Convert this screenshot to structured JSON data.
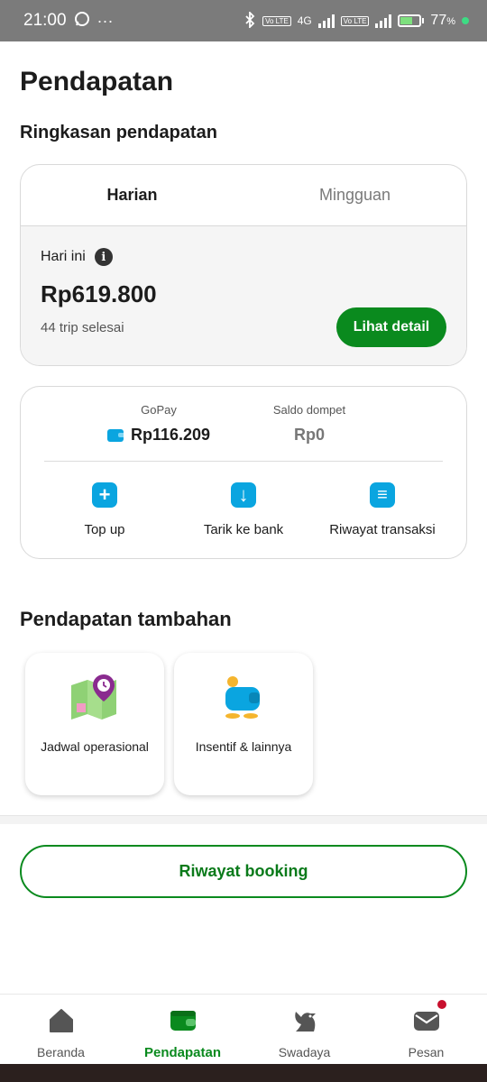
{
  "status_bar": {
    "time": "21:00",
    "more": "···",
    "network_type": "4G",
    "volte_label": "Vo LTE",
    "battery_percent": "77",
    "percent_sign": "%"
  },
  "page": {
    "title": "Pendapatan"
  },
  "summary": {
    "section_title": "Ringkasan pendapatan",
    "tabs": [
      {
        "label": "Harian",
        "active": true
      },
      {
        "label": "Mingguan",
        "active": false
      }
    ],
    "today_label": "Hari ini",
    "info_glyph": "i",
    "amount": "Rp619.800",
    "trips": "44 trip selesai",
    "detail_button": "Lihat detail"
  },
  "wallet": {
    "gopay_label": "GoPay",
    "gopay_value": "Rp116.209",
    "saldo_label": "Saldo dompet",
    "saldo_value": "Rp0",
    "actions": [
      {
        "label": "Top up",
        "icon": "plus-icon",
        "glyph": "+"
      },
      {
        "label": "Tarik ke bank",
        "icon": "download-icon",
        "glyph": "↓"
      },
      {
        "label": "Riwayat transaksi",
        "icon": "history-icon",
        "glyph": "≡"
      }
    ]
  },
  "extra": {
    "section_title": "Pendapatan tambahan",
    "items": [
      {
        "label": "Jadwal operasional",
        "icon": "map-schedule-icon"
      },
      {
        "label": "Insentif & lainnya",
        "icon": "wallet-coins-icon"
      }
    ]
  },
  "booking_button": "Riwayat booking",
  "bottom_nav": [
    {
      "label": "Beranda",
      "icon": "home-icon",
      "active": false
    },
    {
      "label": "Pendapatan",
      "icon": "wallet-icon",
      "active": true
    },
    {
      "label": "Swadaya",
      "icon": "swadaya-bird-icon",
      "active": false
    },
    {
      "label": "Pesan",
      "icon": "mail-icon",
      "active": false,
      "badge": true
    }
  ],
  "colors": {
    "primary_green": "#0a8a1e",
    "gopay_blue": "#0aa5e0",
    "badge_red": "#c8102e"
  }
}
